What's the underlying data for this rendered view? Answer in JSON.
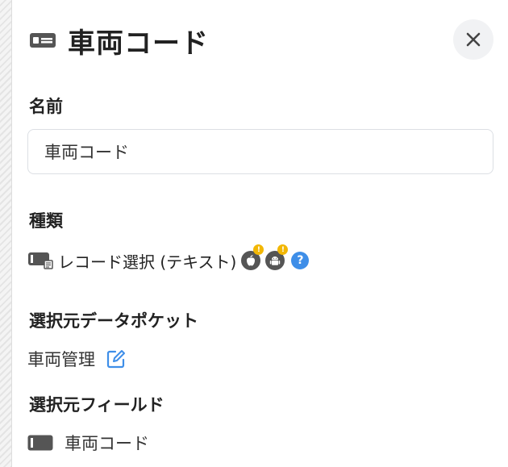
{
  "header": {
    "title": "車両コード",
    "title_icon": "id-card-icon",
    "close_icon": "close-icon"
  },
  "name_section": {
    "label": "名前",
    "input_value": "車両コード"
  },
  "type_section": {
    "label": "種類",
    "type_icon": "record-select-icon",
    "type_text": "レコード選択 (テキスト)",
    "platform_icons": [
      "apple-icon",
      "android-icon"
    ],
    "warning_mark": "!",
    "help_icon": "help-icon",
    "help_symbol": "?"
  },
  "source_pocket_section": {
    "label": "選択元データポケット",
    "value": "車両管理",
    "edit_icon": "edit-icon"
  },
  "source_field_section": {
    "label": "選択元フィールド",
    "value": "車両コード",
    "field_icon": "text-field-icon"
  },
  "colors": {
    "accent_blue": "#3e8ee8",
    "warning_yellow": "#f2b705",
    "icon_gray": "#555555",
    "close_bg": "#f1f2f4"
  }
}
